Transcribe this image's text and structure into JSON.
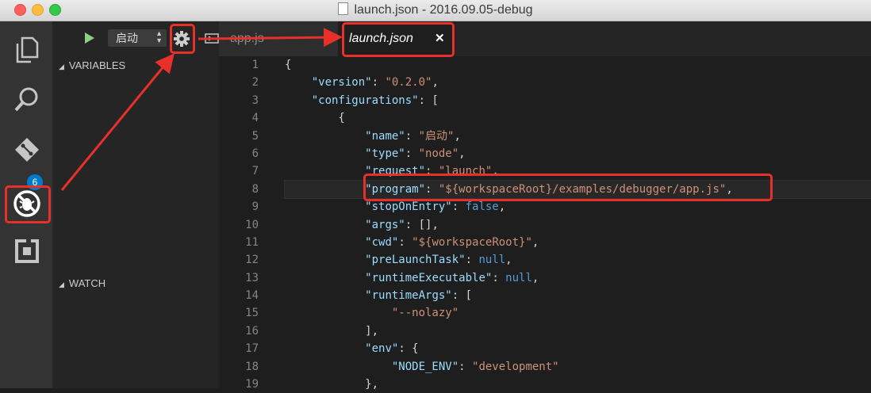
{
  "window": {
    "title": "launch.json - 2016.09.05-debug"
  },
  "activity_bar": {
    "git_badge": "6"
  },
  "debug": {
    "config_name": "启动"
  },
  "sidebar": {
    "variables_header": "VARIABLES",
    "watch_header": "WATCH"
  },
  "tabs": [
    {
      "label": "app.js",
      "active": false
    },
    {
      "label": "launch.json",
      "active": true,
      "close": "✕"
    }
  ],
  "editor": {
    "line_numbers": [
      "1",
      "2",
      "3",
      "4",
      "5",
      "6",
      "7",
      "8",
      "9",
      "10",
      "11",
      "12",
      "13",
      "14",
      "15",
      "16",
      "17",
      "18",
      "19"
    ],
    "current_line": 8,
    "lines": [
      [
        {
          "t": "p",
          "v": "{"
        }
      ],
      [
        {
          "t": "p",
          "v": "    "
        },
        {
          "t": "k",
          "v": "\"version\""
        },
        {
          "t": "p",
          "v": ": "
        },
        {
          "t": "s",
          "v": "\"0.2.0\""
        },
        {
          "t": "p",
          "v": ","
        }
      ],
      [
        {
          "t": "p",
          "v": "    "
        },
        {
          "t": "k",
          "v": "\"configurations\""
        },
        {
          "t": "p",
          "v": ": ["
        }
      ],
      [
        {
          "t": "p",
          "v": "        {"
        }
      ],
      [
        {
          "t": "p",
          "v": "            "
        },
        {
          "t": "k",
          "v": "\"name\""
        },
        {
          "t": "p",
          "v": ": "
        },
        {
          "t": "s",
          "v": "\"启动\""
        },
        {
          "t": "p",
          "v": ","
        }
      ],
      [
        {
          "t": "p",
          "v": "            "
        },
        {
          "t": "k",
          "v": "\"type\""
        },
        {
          "t": "p",
          "v": ": "
        },
        {
          "t": "s",
          "v": "\"node\""
        },
        {
          "t": "p",
          "v": ","
        }
      ],
      [
        {
          "t": "p",
          "v": "            "
        },
        {
          "t": "k",
          "v": "\"request\""
        },
        {
          "t": "p",
          "v": ": "
        },
        {
          "t": "s",
          "v": "\"launch\""
        },
        {
          "t": "p",
          "v": ","
        }
      ],
      [
        {
          "t": "p",
          "v": "            "
        },
        {
          "t": "k",
          "v": "\"program\""
        },
        {
          "t": "p",
          "v": ": "
        },
        {
          "t": "s",
          "v": "\"${workspaceRoot}/examples/debugger/app.js\""
        },
        {
          "t": "p",
          "v": ","
        }
      ],
      [
        {
          "t": "p",
          "v": "            "
        },
        {
          "t": "k",
          "v": "\"stopOnEntry\""
        },
        {
          "t": "p",
          "v": ": "
        },
        {
          "t": "b",
          "v": "false"
        },
        {
          "t": "p",
          "v": ","
        }
      ],
      [
        {
          "t": "p",
          "v": "            "
        },
        {
          "t": "k",
          "v": "\"args\""
        },
        {
          "t": "p",
          "v": ": [],"
        }
      ],
      [
        {
          "t": "p",
          "v": "            "
        },
        {
          "t": "k",
          "v": "\"cwd\""
        },
        {
          "t": "p",
          "v": ": "
        },
        {
          "t": "s",
          "v": "\"${workspaceRoot}\""
        },
        {
          "t": "p",
          "v": ","
        }
      ],
      [
        {
          "t": "p",
          "v": "            "
        },
        {
          "t": "k",
          "v": "\"preLaunchTask\""
        },
        {
          "t": "p",
          "v": ": "
        },
        {
          "t": "b",
          "v": "null"
        },
        {
          "t": "p",
          "v": ","
        }
      ],
      [
        {
          "t": "p",
          "v": "            "
        },
        {
          "t": "k",
          "v": "\"runtimeExecutable\""
        },
        {
          "t": "p",
          "v": ": "
        },
        {
          "t": "b",
          "v": "null"
        },
        {
          "t": "p",
          "v": ","
        }
      ],
      [
        {
          "t": "p",
          "v": "            "
        },
        {
          "t": "k",
          "v": "\"runtimeArgs\""
        },
        {
          "t": "p",
          "v": ": ["
        }
      ],
      [
        {
          "t": "p",
          "v": "                "
        },
        {
          "t": "s",
          "v": "\"--nolazy\""
        }
      ],
      [
        {
          "t": "p",
          "v": "            ],"
        }
      ],
      [
        {
          "t": "p",
          "v": "            "
        },
        {
          "t": "k",
          "v": "\"env\""
        },
        {
          "t": "p",
          "v": ": {"
        }
      ],
      [
        {
          "t": "p",
          "v": "                "
        },
        {
          "t": "k",
          "v": "\"NODE_ENV\""
        },
        {
          "t": "p",
          "v": ": "
        },
        {
          "t": "s",
          "v": "\"development\""
        }
      ],
      [
        {
          "t": "p",
          "v": "            },"
        }
      ]
    ]
  },
  "colors": {
    "annotation": "#e8302a",
    "accent": "#007acc",
    "run_green": "#89d185"
  },
  "icons": [
    "files-icon",
    "search-icon",
    "git-icon",
    "debug-icon",
    "extensions-icon",
    "play-icon",
    "gear-icon",
    "split-editor-icon",
    "close-icon",
    "collapse-triangle-icon"
  ]
}
